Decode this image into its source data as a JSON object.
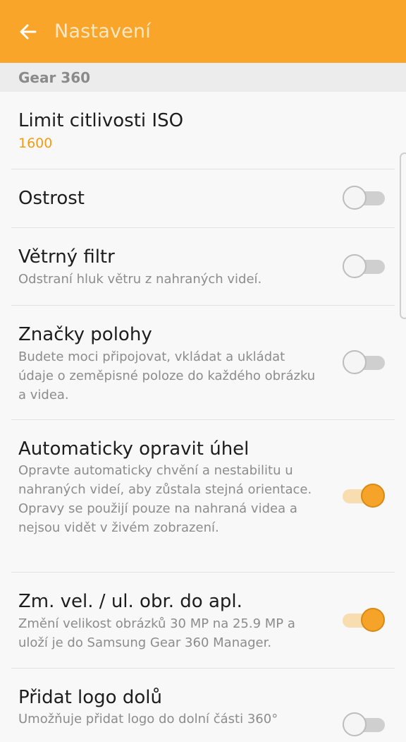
{
  "appbar": {
    "title": "Nastavení",
    "back_icon": "arrow-left-icon",
    "background": "#f8a52a"
  },
  "section": {
    "label": "Gear 360"
  },
  "items": [
    {
      "title": "Limit citlivosti ISO",
      "value": "1600"
    },
    {
      "title": "Ostrost",
      "toggle": false
    },
    {
      "title": "Větrný filtr",
      "subtitle": "Odstraní hluk větru z nahraných videí.",
      "toggle": false
    },
    {
      "title": "Značky polohy",
      "subtitle": "Budete moci připojovat, vkládat a ukládat údaje o zeměpisné poloze do každého obrázku a videa.",
      "toggle": false
    },
    {
      "title": "Automaticky opravit úhel",
      "subtitle": "Opravte automaticky chvění a nestabilitu u nahraných videí, aby zůstala stejná orientace. Opravy se použijí pouze na nahraná videa a nejsou vidět v živém zobrazení.",
      "toggle": true
    },
    {
      "title": "Zm. vel. / ul. obr. do apl.",
      "subtitle": "Změní velikost obrázků 30 MP na 25.9 MP a uloží je do Samsung Gear 360 Manager.",
      "toggle": true
    },
    {
      "title": "Přidat logo dolů",
      "subtitle": "Umožňuje přidat logo do dolní části 360°",
      "toggle": false
    }
  ],
  "colors": {
    "accent": "#f6a32a",
    "value_text": "#f39c12"
  }
}
